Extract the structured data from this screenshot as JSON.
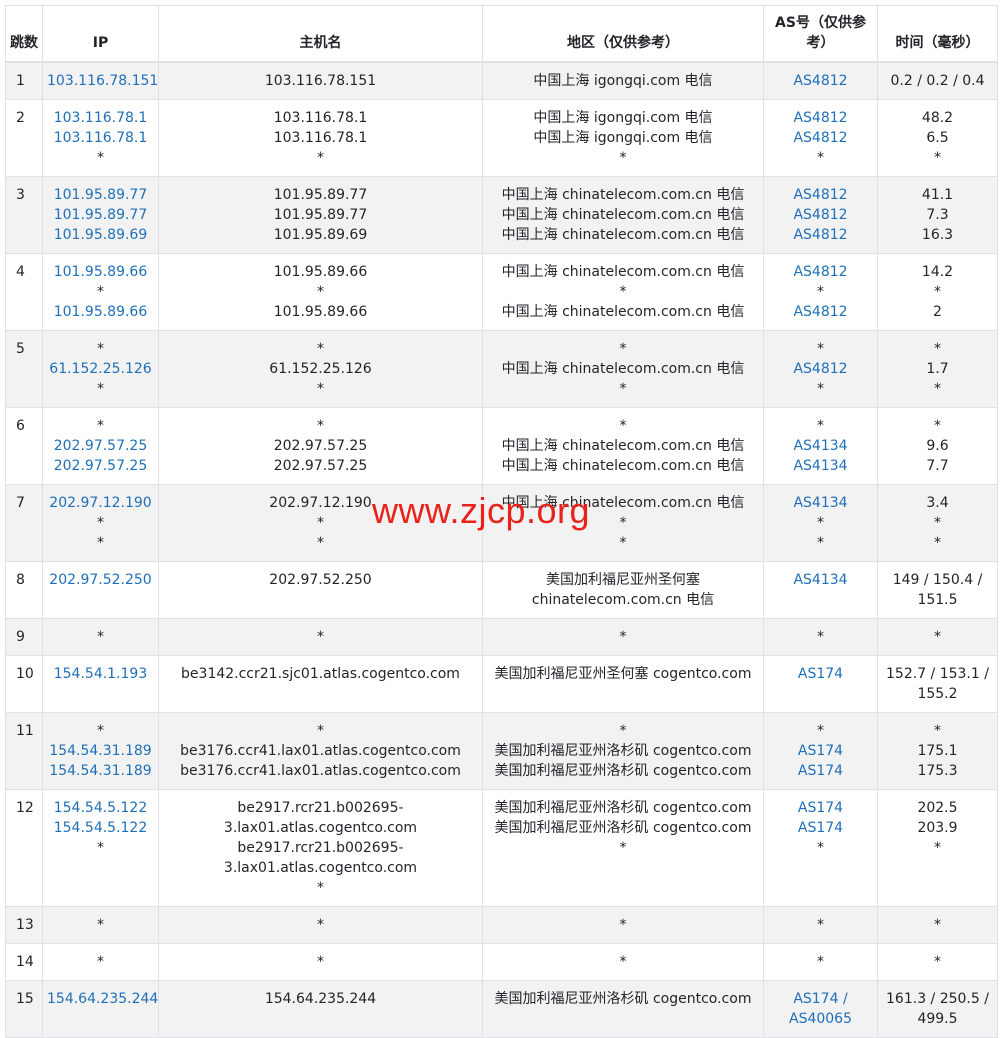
{
  "headers": {
    "hop": "跳数",
    "ip": "IP",
    "host": "主机名",
    "region": "地区（仅供参考）",
    "as": "AS号（仅供参考）",
    "time": "时间（毫秒）"
  },
  "colors": {
    "link": "#1f6fb8",
    "watermark": "#e8231b",
    "stripe": "#f2f2f2",
    "border": "#dee2e6"
  },
  "watermark": "www.zjcp.org",
  "rows": [
    {
      "hop": "1",
      "ip": [
        "103.116.78.151"
      ],
      "host": [
        "103.116.78.151"
      ],
      "region": [
        "中国上海 igongqi.com 电信"
      ],
      "as": [
        "AS4812"
      ],
      "time": [
        "0.2 / 0.2 / 0.4"
      ]
    },
    {
      "hop": "2",
      "ip": [
        "103.116.78.1",
        "103.116.78.1",
        "*"
      ],
      "host": [
        "103.116.78.1",
        "103.116.78.1",
        "*"
      ],
      "region": [
        "中国上海 igongqi.com 电信",
        "中国上海 igongqi.com 电信",
        "*"
      ],
      "as": [
        "AS4812",
        "AS4812",
        "*"
      ],
      "time": [
        "48.2",
        "6.5",
        "*"
      ]
    },
    {
      "hop": "3",
      "ip": [
        "101.95.89.77",
        "101.95.89.77",
        "101.95.89.69"
      ],
      "host": [
        "101.95.89.77",
        "101.95.89.77",
        "101.95.89.69"
      ],
      "region": [
        "中国上海 chinatelecom.com.cn 电信",
        "中国上海 chinatelecom.com.cn 电信",
        "中国上海 chinatelecom.com.cn 电信"
      ],
      "as": [
        "AS4812",
        "AS4812",
        "AS4812"
      ],
      "time": [
        "41.1",
        "7.3",
        "16.3"
      ]
    },
    {
      "hop": "4",
      "ip": [
        "101.95.89.66",
        "*",
        "101.95.89.66"
      ],
      "host": [
        "101.95.89.66",
        "*",
        "101.95.89.66"
      ],
      "region": [
        "中国上海 chinatelecom.com.cn 电信",
        "*",
        "中国上海 chinatelecom.com.cn 电信"
      ],
      "as": [
        "AS4812",
        "*",
        "AS4812"
      ],
      "time": [
        "14.2",
        "*",
        "2"
      ]
    },
    {
      "hop": "5",
      "ip": [
        "*",
        "61.152.25.126",
        "*"
      ],
      "host": [
        "*",
        "61.152.25.126",
        "*"
      ],
      "region": [
        "*",
        "中国上海 chinatelecom.com.cn 电信",
        "*"
      ],
      "as": [
        "*",
        "AS4812",
        "*"
      ],
      "time": [
        "*",
        "1.7",
        "*"
      ]
    },
    {
      "hop": "6",
      "ip": [
        "*",
        "202.97.57.25",
        "202.97.57.25"
      ],
      "host": [
        "*",
        "202.97.57.25",
        "202.97.57.25"
      ],
      "region": [
        "*",
        "中国上海 chinatelecom.com.cn 电信",
        "中国上海 chinatelecom.com.cn 电信"
      ],
      "as": [
        "*",
        "AS4134",
        "AS4134"
      ],
      "time": [
        "*",
        "9.6",
        "7.7"
      ]
    },
    {
      "hop": "7",
      "ip": [
        "202.97.12.190",
        "*",
        "*"
      ],
      "host": [
        "202.97.12.190",
        "*",
        "*"
      ],
      "region": [
        "中国上海 chinatelecom.com.cn 电信",
        "*",
        "*"
      ],
      "as": [
        "AS4134",
        "*",
        "*"
      ],
      "time": [
        "3.4",
        "*",
        "*"
      ]
    },
    {
      "hop": "8",
      "ip": [
        "202.97.52.250"
      ],
      "host": [
        "202.97.52.250"
      ],
      "region": [
        "美国加利福尼亚州圣何塞 chinatelecom.com.cn 电信"
      ],
      "as": [
        "AS4134"
      ],
      "time": [
        "149 / 150.4 / 151.5"
      ]
    },
    {
      "hop": "9",
      "ip": [
        "*"
      ],
      "host": [
        "*"
      ],
      "region": [
        "*"
      ],
      "as": [
        "*"
      ],
      "time": [
        "*"
      ]
    },
    {
      "hop": "10",
      "ip": [
        "154.54.1.193"
      ],
      "host": [
        "be3142.ccr21.sjc01.atlas.cogentco.com"
      ],
      "region": [
        "美国加利福尼亚州圣何塞 cogentco.com"
      ],
      "as": [
        "AS174"
      ],
      "time": [
        "152.7 / 153.1 / 155.2"
      ]
    },
    {
      "hop": "11",
      "ip": [
        "*",
        "154.54.31.189",
        "154.54.31.189"
      ],
      "host": [
        "*",
        "be3176.ccr41.lax01.atlas.cogentco.com",
        "be3176.ccr41.lax01.atlas.cogentco.com"
      ],
      "region": [
        "*",
        "美国加利福尼亚州洛杉矶 cogentco.com",
        "美国加利福尼亚州洛杉矶 cogentco.com"
      ],
      "as": [
        "*",
        "AS174",
        "AS174"
      ],
      "time": [
        "*",
        "175.1",
        "175.3"
      ]
    },
    {
      "hop": "12",
      "ip": [
        "154.54.5.122",
        "154.54.5.122",
        "*"
      ],
      "host": [
        "be2917.rcr21.b002695-3.lax01.atlas.cogentco.com",
        "be2917.rcr21.b002695-3.lax01.atlas.cogentco.com",
        "*"
      ],
      "region": [
        "美国加利福尼亚州洛杉矶 cogentco.com",
        "美国加利福尼亚州洛杉矶 cogentco.com",
        "*"
      ],
      "as": [
        "AS174",
        "AS174",
        "*"
      ],
      "time": [
        "202.5",
        "203.9",
        "*"
      ]
    },
    {
      "hop": "13",
      "ip": [
        "*"
      ],
      "host": [
        "*"
      ],
      "region": [
        "*"
      ],
      "as": [
        "*"
      ],
      "time": [
        "*"
      ]
    },
    {
      "hop": "14",
      "ip": [
        "*"
      ],
      "host": [
        "*"
      ],
      "region": [
        "*"
      ],
      "as": [
        "*"
      ],
      "time": [
        "*"
      ]
    },
    {
      "hop": "15",
      "ip": [
        "154.64.235.244"
      ],
      "host": [
        "154.64.235.244"
      ],
      "region": [
        "美国加利福尼亚州洛杉矶 cogentco.com"
      ],
      "as": [
        "AS174 / AS40065"
      ],
      "time": [
        "161.3 / 250.5 / 499.5"
      ]
    }
  ]
}
